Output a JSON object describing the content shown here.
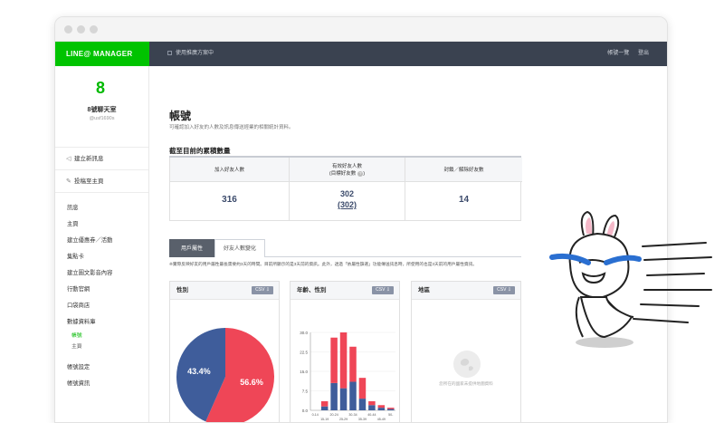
{
  "topbar": {
    "brand": "LINE@ MANAGER",
    "plan_text": "使用推廣方案中",
    "links": [
      "帳號一覽",
      "登出"
    ]
  },
  "sidebar": {
    "account": {
      "name": "8號聊天室",
      "id": "@usf1690s",
      "logo_glyph": "8"
    },
    "actions": [
      {
        "label": "建立新訊息",
        "icon": "megaphone-icon"
      },
      {
        "label": "投稿至主頁",
        "icon": "edit-icon"
      }
    ],
    "items": [
      "訊息",
      "主頁",
      "建立優惠券／活動",
      "集點卡",
      "建立圖文影音內容",
      "行動官網",
      "口袋商店",
      "數據資料庫"
    ],
    "sub_items": [
      {
        "label": "帳號",
        "active": true
      },
      {
        "label": "主頁",
        "active": false
      }
    ],
    "bottom_items": [
      "帳號設定",
      "帳號資訊"
    ]
  },
  "main": {
    "title": "帳號",
    "description": "可確認加入好友的人數及訊息傳送經業的相關統計資料。",
    "section_title": "截至目前的累積數量",
    "totals": [
      {
        "label": "加入好友人數",
        "value": "316"
      },
      {
        "label": "有效好友人數",
        "label2": "(目標好友數",
        "value": "302",
        "value2": "(302)"
      },
      {
        "label": "封鎖／解除好友數",
        "value": "14"
      }
    ],
    "tabs": [
      {
        "label": "用戶屬性",
        "active": true
      },
      {
        "label": "好友人數變化",
        "active": false
      }
    ],
    "note": "※實際反映好友的用戶屬性最長需要約3天的時間。目前所顯示的是3天前的資訊。此外，透過「依屬性篩選」功能傳送訊息時，所使用的也是3天前的用戶屬性資訊。",
    "cards": [
      {
        "title": "性別",
        "csv": "CSV ⇩"
      },
      {
        "title": "年齡、性別",
        "csv": "CSV ⇩"
      },
      {
        "title": "地區",
        "csv": "CSV ⇩",
        "empty_text": "您所在的國家未提供地圖資料"
      }
    ]
  },
  "chart_data": [
    {
      "type": "pie",
      "title": "性別",
      "labels": [
        "",
        ""
      ],
      "values": [
        43.4,
        56.6
      ],
      "value_labels": [
        "43.4%",
        "56.6%"
      ],
      "colors": [
        "#3f5d9b",
        "#ef4657"
      ]
    },
    {
      "type": "bar",
      "title": "年齡、性別",
      "stacked": true,
      "categories": [
        "0-14",
        "15-19",
        "20-24",
        "25-29",
        "30-34",
        "35-39",
        "40-44",
        "45-49",
        "50-"
      ],
      "x_tick_labels_row1": [
        "0-14",
        "20-24",
        "30-34",
        "40-44",
        "50-"
      ],
      "x_tick_labels_row2": [
        "15-19",
        "25-29",
        "35-39",
        "45-49"
      ],
      "series": [
        {
          "values": [
            0,
            1.5,
            10.5,
            8.5,
            11,
            4.5,
            2,
            1,
            0.5
          ],
          "color": "#3f5d9b"
        },
        {
          "values": [
            0,
            2,
            17.5,
            21.5,
            13.5,
            8,
            1.5,
            1,
            0.5
          ],
          "color": "#ef4657"
        }
      ],
      "ylim": [
        0,
        30
      ],
      "yticks": [
        "0.0",
        "7.5",
        "15.0",
        "22.5",
        "30.0"
      ],
      "grid": true
    }
  ]
}
